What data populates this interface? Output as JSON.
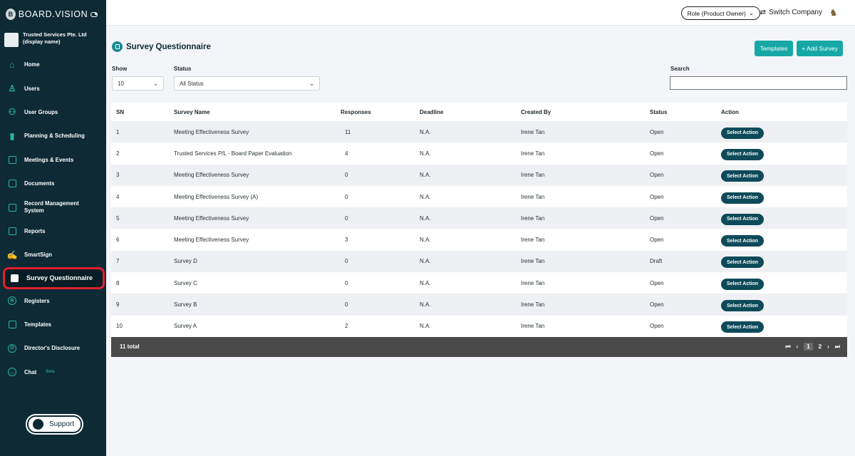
{
  "app": {
    "logo_text": "BOARD.VISION",
    "logo_mark": "B"
  },
  "company": {
    "name": "Trusted Services Pte. Ltd",
    "display": "(display name)"
  },
  "sidebar": {
    "items": [
      {
        "label": "Home",
        "icon": "home-icon"
      },
      {
        "label": "Users",
        "icon": "user-icon"
      },
      {
        "label": "User Groups",
        "icon": "user-groups-icon"
      },
      {
        "label": "Planning & Scheduling",
        "icon": "bar-chart-icon"
      },
      {
        "label": "Meetings & Events",
        "icon": "calendar-icon"
      },
      {
        "label": "Documents",
        "icon": "documents-icon"
      },
      {
        "label": "Record Management",
        "label2": "System",
        "icon": "record-icon"
      },
      {
        "label": "Reports",
        "icon": "reports-icon"
      },
      {
        "label": "SmartSign",
        "icon": "signature-icon"
      },
      {
        "label": "Survey Questionnaire",
        "icon": "survey-icon"
      },
      {
        "label": "Registers",
        "icon": "registered-icon"
      },
      {
        "label": "Templates",
        "icon": "templates-icon"
      },
      {
        "label": "Director's Disclosure",
        "icon": "disclosure-icon"
      },
      {
        "label": "Chat",
        "badge": "Beta",
        "icon": "chat-icon"
      }
    ],
    "support_label": "Support"
  },
  "topbar": {
    "role_label": "Role (Product Owner)",
    "switch_label": "Switch Company"
  },
  "page": {
    "title": "Survey Questionnaire",
    "templates_button": "Templates",
    "add_button": "+ Add Survey",
    "show_label": "Show",
    "show_value": "10",
    "status_label": "Status",
    "status_value": "All Status",
    "search_label": "Search",
    "search_value": ""
  },
  "table": {
    "headers": [
      "SN",
      "Survey Name",
      "Responses",
      "Deadline",
      "Created By",
      "Status",
      "Action"
    ],
    "rows": [
      [
        "1",
        "Meeting Effectiveness Survey",
        "11",
        "N.A.",
        "Irene Tan",
        "Open"
      ],
      [
        "2",
        "Trusted Services P/L - Board Paper Evaluation",
        "4",
        "N.A.",
        "Irene Tan",
        "Open"
      ],
      [
        "3",
        "Meeting Effectiveness Survey",
        "0",
        "N.A.",
        "Irene Tan",
        "Open"
      ],
      [
        "4",
        "Meeting Effectiveness Survey (A)",
        "0",
        "N.A.",
        "Irene Tan",
        "Open"
      ],
      [
        "5",
        "Meeting Effectiveness Survey",
        "0",
        "N.A.",
        "Irene Tan",
        "Open"
      ],
      [
        "6",
        "Meeting Effectiveness Survey",
        "3",
        "N.A.",
        "Irene Tan",
        "Open"
      ],
      [
        "7",
        "Survey D",
        "0",
        "N.A.",
        "Irene Tan",
        "Draft"
      ],
      [
        "8",
        "Survey C",
        "0",
        "N.A.",
        "Irene Tan",
        "Open"
      ],
      [
        "9",
        "Survey B",
        "0",
        "N.A.",
        "Irene Tan",
        "Open"
      ],
      [
        "10",
        "Survey A",
        "2",
        "N.A.",
        "Irene Tan",
        "Open"
      ]
    ],
    "action_label": "Select Action",
    "footer_total": "11 total",
    "pager": {
      "first": "⏮",
      "prev": "‹",
      "page1": "1",
      "page2": "2",
      "next": "›",
      "last": "⏭"
    }
  },
  "colors": {
    "sidebar_bg": "#0d2a35",
    "accent": "#17a8a6",
    "active_outline": "#e0202a"
  }
}
